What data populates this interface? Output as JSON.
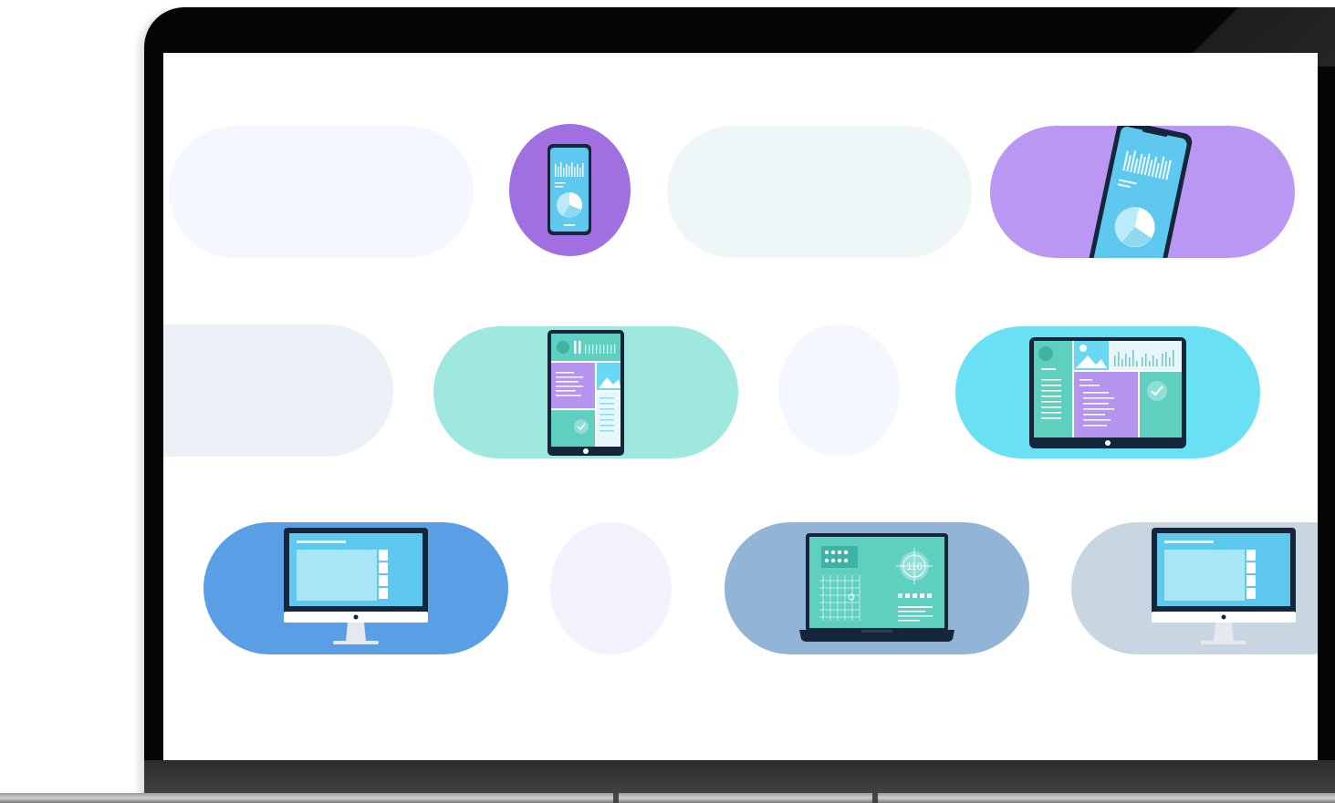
{
  "colors": {
    "purple": "#a06fe0",
    "lavender": "#b997f2",
    "mint": "#9ee8df",
    "cyan": "#6ae0f4",
    "blue": "#5a9fe6",
    "steel": "#92b4d6",
    "slate": "#c8d6e2",
    "faint_blue": "#f4f7fd",
    "faint_teal": "#eef6f8",
    "faint_gray": "#ecf1f7",
    "faint_lilac": "#f4f1fc"
  },
  "illustrations": {
    "phone_small": {
      "icon": "smartphone-icon"
    },
    "phone_large": {
      "icon": "smartphone-icon"
    },
    "tablet_portrait": {
      "icon": "tablet-icon"
    },
    "tablet_landscape": {
      "icon": "tablet-icon"
    },
    "monitor_left": {
      "icon": "desktop-monitor-icon"
    },
    "laptop_center": {
      "icon": "laptop-icon",
      "display_value": "110"
    },
    "monitor_right": {
      "icon": "desktop-monitor-icon"
    }
  }
}
